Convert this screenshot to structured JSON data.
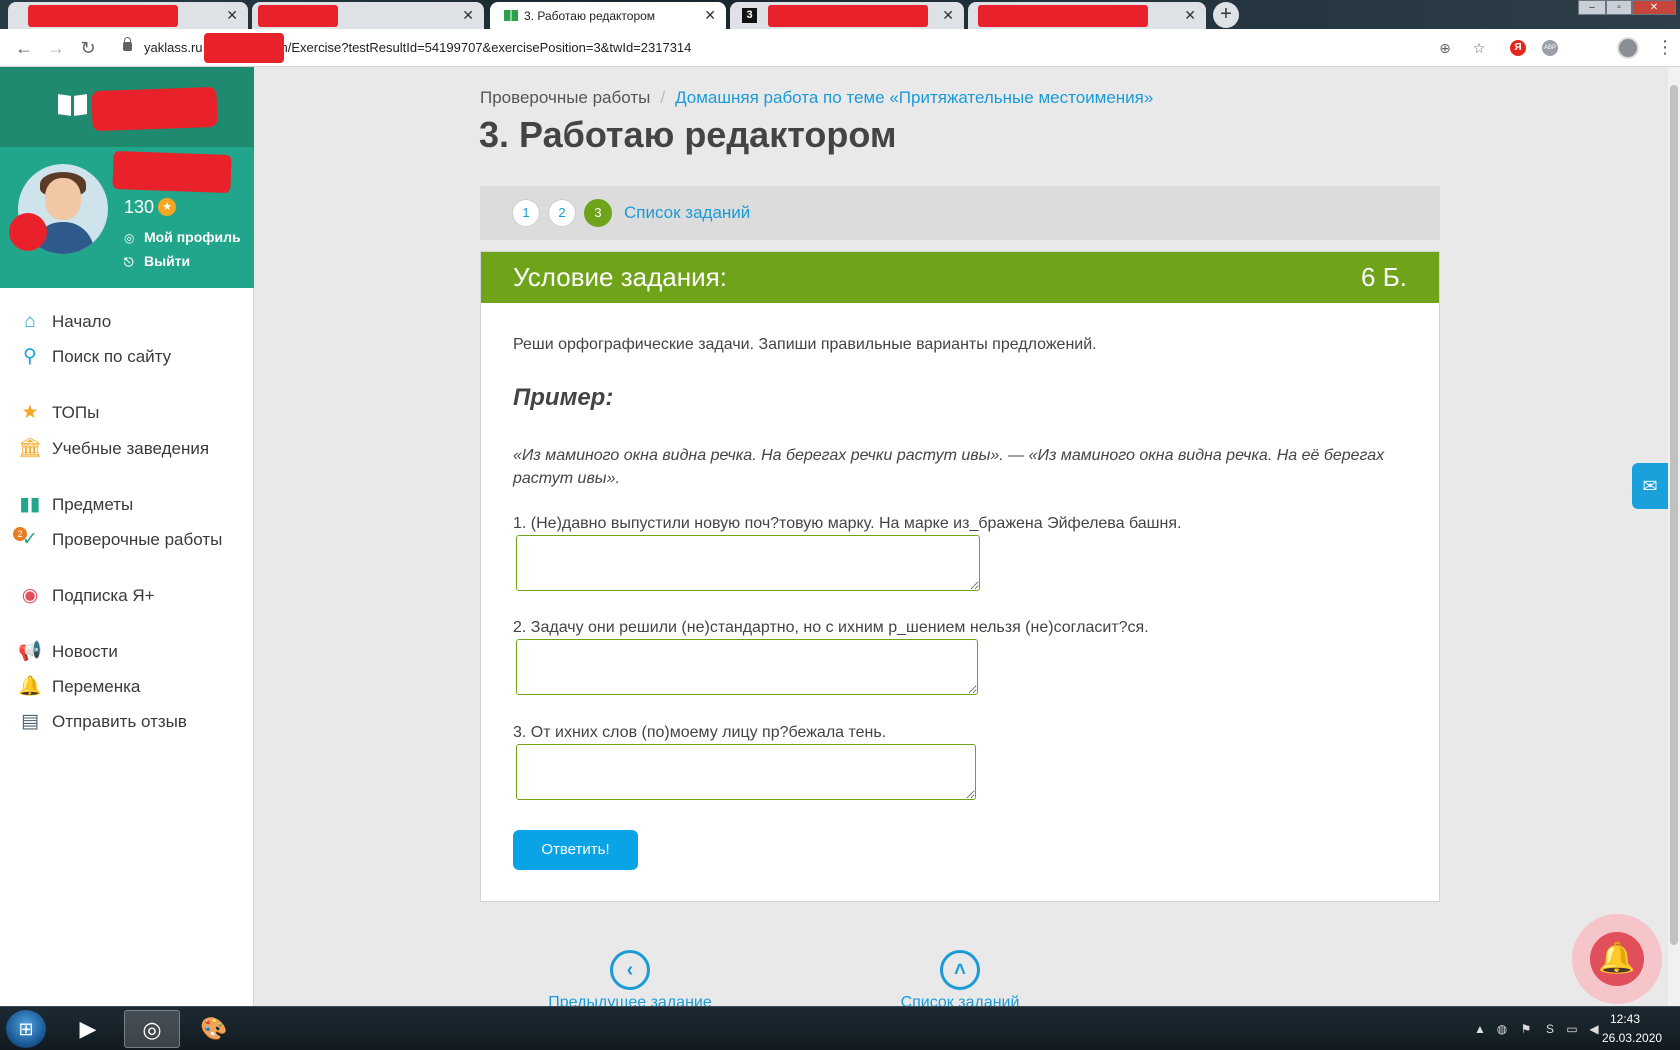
{
  "browser": {
    "active_tab_title": "3. Работаю редактором",
    "url_visible_start": "yaklass.ru",
    "url_visible_end": "n/Exercise?testResultId=54199707&exercisePosition=3&twId=2317314",
    "new_tab_label": "+"
  },
  "sidebar": {
    "points": "130",
    "profile_link": "Мой профиль",
    "logout_link": "Выйти",
    "check_works_badge": "2",
    "nav": [
      {
        "label": "Начало",
        "icon": "home-icon"
      },
      {
        "label": "Поиск по сайту",
        "icon": "search-icon"
      },
      {
        "label": "ТОПы",
        "icon": "star-icon"
      },
      {
        "label": "Учебные заведения",
        "icon": "institution-icon"
      },
      {
        "label": "Предметы",
        "icon": "subjects-icon"
      },
      {
        "label": "Проверочные работы",
        "icon": "check-icon"
      },
      {
        "label": "Подписка Я+",
        "icon": "subscription-icon"
      },
      {
        "label": "Новости",
        "icon": "news-icon"
      },
      {
        "label": "Переменка",
        "icon": "bell-icon"
      },
      {
        "label": "Отправить отзыв",
        "icon": "feedback-icon"
      }
    ]
  },
  "breadcrumb": {
    "item1": "Проверочные работы",
    "separator": "/",
    "item2": "Домашняя работа по теме «Притяжательные местоимения»"
  },
  "page_title": "3. Работаю редактором",
  "task_nav": {
    "tasks": [
      "1",
      "2",
      "3"
    ],
    "current": "3",
    "list_link": "Список заданий"
  },
  "task": {
    "header": "Условие задания:",
    "points": "6 Б.",
    "instruction": "Реши орфографические задачи. Запиши правильные варианты предложений.",
    "example_title": "Пример:",
    "example_text": "«Из маминого окна видна речка. На берегах речки растут ивы». —  «Из маминого окна видна речка. На её берегах растут ивы».",
    "questions": [
      {
        "label": "1. (Не)давно выпустили новую поч?товую марку. На марке из_бражена Эйфелева башня.",
        "value": ""
      },
      {
        "label": "2. Задачу они решили (не)стандартно, но с ихним р_шением нельзя (не)согласит?ся.",
        "value": ""
      },
      {
        "label": "3. От ихних слов (по)моему лицу пр?бежала тень.",
        "value": ""
      }
    ],
    "submit": "Ответить!"
  },
  "bottom_nav": {
    "prev": "Предыдущее задание",
    "list": "Список заданий"
  },
  "taskbar": {
    "time": "12:43",
    "date": "26.03.2020"
  },
  "colors": {
    "accent_green": "#6fa31a",
    "brand_teal": "#22a68b",
    "link_blue": "#1a9bd7",
    "button_blue": "#0aa4e6",
    "redaction_red": "#e8212a"
  }
}
